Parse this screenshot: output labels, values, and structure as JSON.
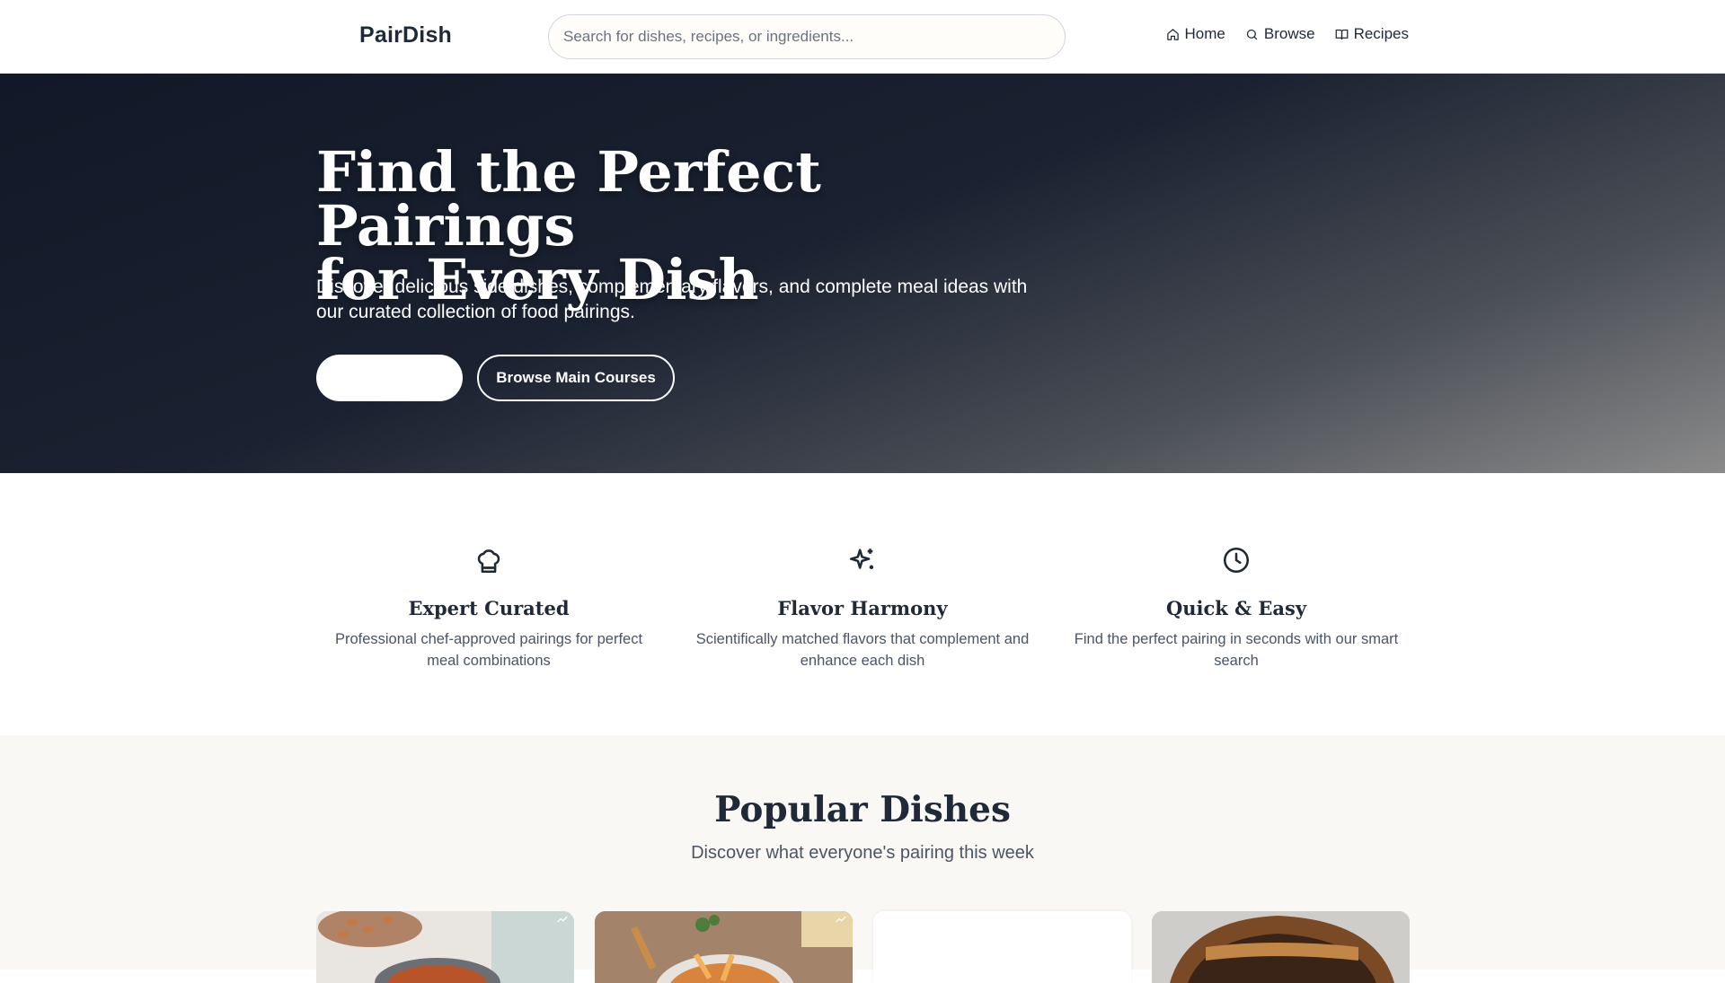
{
  "header": {
    "brand": "PairDish",
    "search_placeholder": "Search for dishes, recipes, or ingredients...",
    "nav": [
      {
        "label": "Home",
        "icon": "home-icon"
      },
      {
        "label": "Browse",
        "icon": "search-icon"
      },
      {
        "label": "Recipes",
        "icon": "book-icon"
      }
    ]
  },
  "hero": {
    "title_line1": "Find the Perfect Pairings",
    "title_line2": "for Every Dish",
    "subtitle": "Discover delicious side dishes, complementary flavors, and complete meal ideas with our curated collection of food pairings.",
    "primary_button_label": "",
    "secondary_button_label": "Browse Main Courses"
  },
  "features": [
    {
      "icon": "chef-hat-icon",
      "title": "Expert Curated",
      "text": "Professional chef-approved pairings for perfect meal combinations"
    },
    {
      "icon": "sparkles-icon",
      "title": "Flavor Harmony",
      "text": "Scientifically matched flavors that complement and enhance each dish"
    },
    {
      "icon": "clock-icon",
      "title": "Quick & Easy",
      "text": "Find the perfect pairing in seconds with our smart search"
    }
  ],
  "popular": {
    "title": "Popular Dishes",
    "subtitle": "Discover what everyone's pairing this week"
  },
  "colors": {
    "hero_dark": "#111827",
    "hero_light": "#8a8a8a",
    "text_dark": "#1f2937",
    "section_bg": "#faf8f5"
  }
}
